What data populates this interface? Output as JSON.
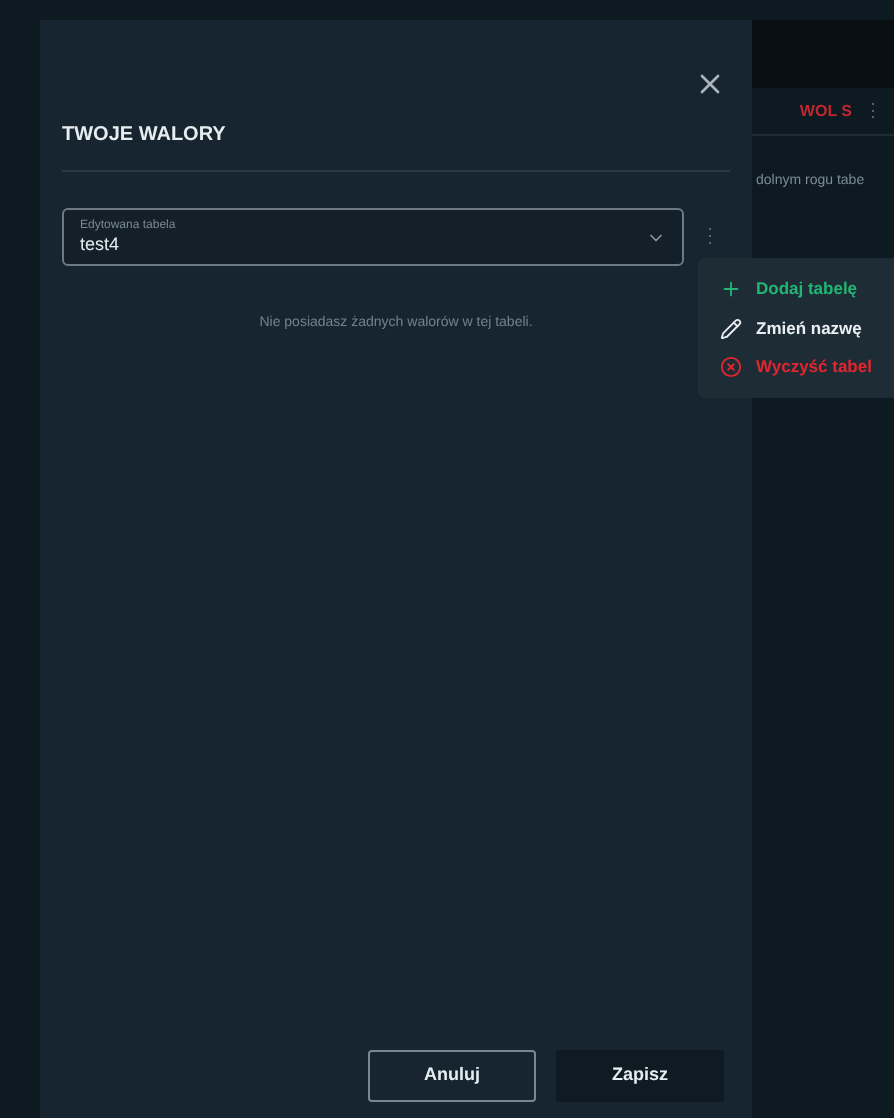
{
  "background_page": {
    "column_label": "WOL S",
    "menu_glyph": "⋮",
    "hint": "dolnym rogu tabe"
  },
  "dialog": {
    "title": "TWOJE WALORY",
    "table_select": {
      "label": "Edytowana tabela",
      "value": "test4"
    },
    "more_glyph": "⋮",
    "empty_message": "Nie posiadasz żadnych walorów w tej tabeli.",
    "buttons": [
      {
        "label": "Anuluj",
        "kind": "secondary"
      },
      {
        "label": "Zapisz",
        "kind": "primary"
      }
    ]
  },
  "menu": {
    "items": [
      {
        "label": "Dodaj tabelę",
        "kind": "add",
        "color": "#22b573"
      },
      {
        "label": "Zmień nazwę",
        "kind": "rename",
        "color": "#e8eef2"
      },
      {
        "label": "Wyczyść tabel",
        "kind": "clear",
        "color": "#e0262f"
      }
    ]
  }
}
